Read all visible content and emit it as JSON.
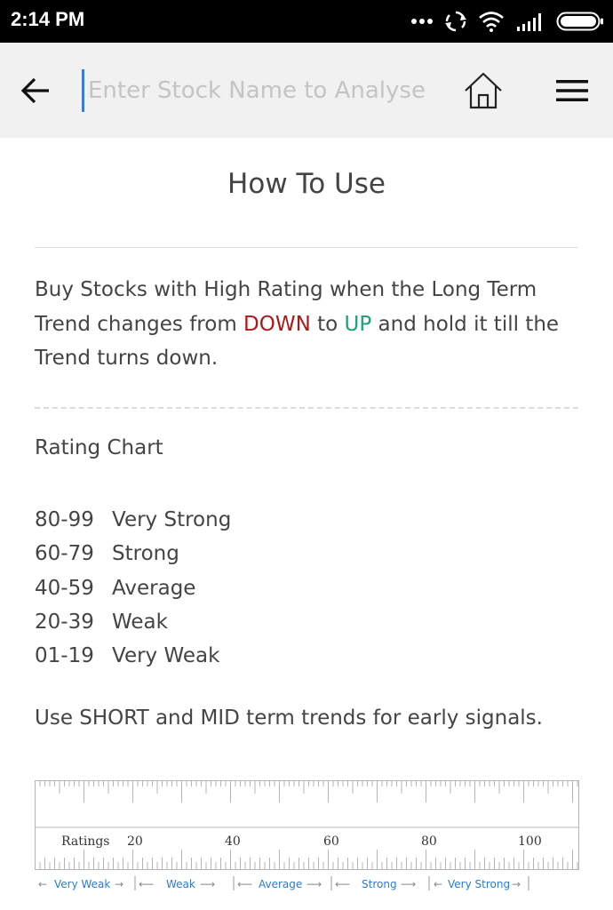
{
  "status_bar": {
    "time": "2:14 PM",
    "icons": [
      "more-dots-icon",
      "sync-icon",
      "wifi-icon",
      "signal-icon",
      "battery-icon"
    ]
  },
  "toolbar": {
    "search_placeholder": "Enter Stock Name to Analyse",
    "icons": [
      "back-arrow-icon",
      "home-icon",
      "menu-icon"
    ]
  },
  "page": {
    "title": "How To Use",
    "intro": {
      "part1": "Buy Stocks with High Rating when the Long Term Trend changes from ",
      "down": "DOWN",
      "part2": " to ",
      "up": "UP",
      "part3": " and hold it till the Trend turns down."
    },
    "rating_heading": "Rating Chart",
    "ratings": [
      {
        "range": "80-99",
        "label": "Very Strong"
      },
      {
        "range": "60-79",
        "label": "Strong"
      },
      {
        "range": "40-59",
        "label": "Average"
      },
      {
        "range": "20-39",
        "label": "Weak"
      },
      {
        "range": "01-19",
        "label": "Very Weak"
      }
    ],
    "early_note": "Use SHORT and MID term trends for early signals."
  },
  "ruler": {
    "label": "Ratings",
    "ticks": [
      "20",
      "40",
      "60",
      "80",
      "100"
    ],
    "bands": [
      "Very Weak",
      "Weak",
      "Average",
      "Strong",
      "Very Strong"
    ]
  },
  "colors": {
    "down": "#b01818",
    "up": "#1aa37a",
    "ruler_line": "#b5b5b5",
    "ruler_text": "#333333",
    "band_text": "#2b7bd6"
  }
}
